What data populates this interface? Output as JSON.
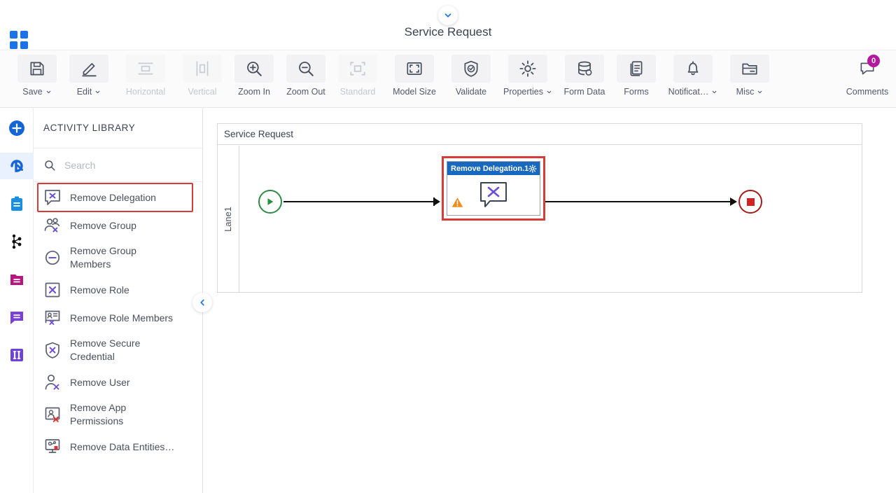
{
  "header": {
    "title": "Service Request",
    "app_grid_icon": "app-grid-icon",
    "chevron_icon": "chevron-down-icon"
  },
  "toolbar": {
    "items": [
      {
        "label": "Save",
        "icon": "save-icon",
        "caret": true,
        "disabled": false
      },
      {
        "label": "Edit",
        "icon": "pencil-icon",
        "caret": true,
        "disabled": false
      },
      {
        "label": "Horizontal",
        "icon": "horizontal-icon",
        "caret": false,
        "disabled": true
      },
      {
        "label": "Vertical",
        "icon": "vertical-icon",
        "caret": false,
        "disabled": true
      },
      {
        "label": "Zoom In",
        "icon": "zoom-in-icon",
        "caret": false,
        "disabled": false
      },
      {
        "label": "Zoom Out",
        "icon": "zoom-out-icon",
        "caret": false,
        "disabled": false
      },
      {
        "label": "Standard",
        "icon": "standard-icon",
        "caret": false,
        "disabled": true
      },
      {
        "label": "Model Size",
        "icon": "model-size-icon",
        "caret": false,
        "disabled": false
      },
      {
        "label": "Validate",
        "icon": "validate-icon",
        "caret": false,
        "disabled": false
      },
      {
        "label": "Properties",
        "icon": "gear-icon",
        "caret": true,
        "disabled": false
      },
      {
        "label": "Form Data",
        "icon": "database-icon",
        "caret": false,
        "disabled": false
      },
      {
        "label": "Forms",
        "icon": "forms-icon",
        "caret": false,
        "disabled": false
      },
      {
        "label": "Notificat…",
        "icon": "bell-icon",
        "caret": true,
        "disabled": false
      },
      {
        "label": "Misc",
        "icon": "folder-icon",
        "caret": true,
        "disabled": false
      }
    ],
    "comments": {
      "label": "Comments",
      "icon": "comment-icon",
      "badge_count": "0",
      "badge_color": "#b5179e"
    }
  },
  "rail": {
    "items": [
      {
        "name": "add-icon",
        "active": false
      },
      {
        "name": "activity-icon",
        "active": true
      },
      {
        "name": "clipboard-icon",
        "active": false
      },
      {
        "name": "hierarchy-icon",
        "active": false
      },
      {
        "name": "folder-icon",
        "active": false
      },
      {
        "name": "chat-icon",
        "active": false
      },
      {
        "name": "columns-icon",
        "active": false
      }
    ]
  },
  "library": {
    "title": "ACTIVITY LIBRARY",
    "search": {
      "value": "",
      "placeholder": "Search",
      "icon": "search-icon"
    },
    "collapse_icon": "chevron-left-icon",
    "highlight_color": "#d93a3a",
    "items": [
      {
        "label": "Remove Delegation",
        "icon": "remove-delegation-icon",
        "highlighted": true
      },
      {
        "label": "Remove Group",
        "icon": "remove-group-icon",
        "highlighted": false
      },
      {
        "label": "Remove Group Members",
        "icon": "remove-group-members-icon",
        "highlighted": false
      },
      {
        "label": "Remove Role",
        "icon": "remove-role-icon",
        "highlighted": false
      },
      {
        "label": "Remove Role Members",
        "icon": "remove-role-members-icon",
        "highlighted": false
      },
      {
        "label": "Remove Secure Credential",
        "icon": "remove-secure-credential-icon",
        "highlighted": false
      },
      {
        "label": "Remove User",
        "icon": "remove-user-icon",
        "highlighted": false
      },
      {
        "label": "Remove App Permissions",
        "icon": "remove-app-permissions-icon",
        "highlighted": false
      },
      {
        "label": "Remove Data Entities…",
        "icon": "remove-data-entities-icon",
        "highlighted": false
      }
    ]
  },
  "canvas": {
    "pool_title": "Service Request",
    "lane_label": "Lane1",
    "start_node": {
      "name": "start-event",
      "icon": "play-icon",
      "color": "#2e8b45"
    },
    "end_node": {
      "name": "end-event",
      "icon": "stop-icon",
      "color": "#a51c1c"
    },
    "activity": {
      "title": "Remove Delegation.1",
      "header_color": "#1868c0",
      "selection_color": "#d93a3a",
      "gear_icon": "gear-icon",
      "body_icon": "remove-delegation-icon",
      "warning_icon": "warning-icon"
    }
  }
}
